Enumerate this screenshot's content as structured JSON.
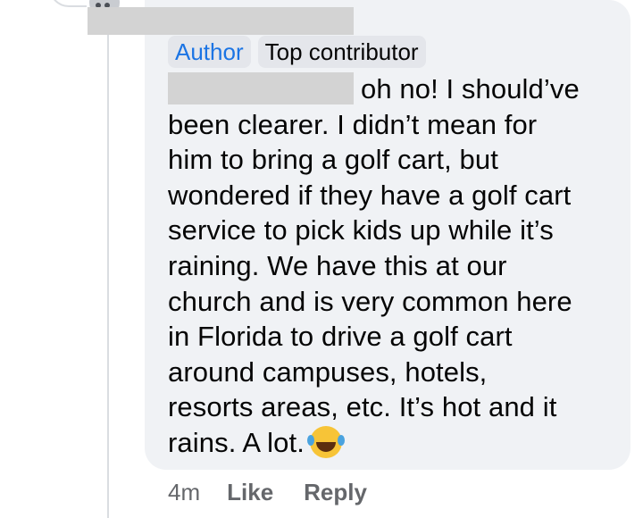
{
  "comment": {
    "badges": {
      "author": "Author",
      "top_contributor": "Top contributor"
    },
    "text_lines": [
      "oh no! I should’ve",
      "been clearer. I didn’t mean for",
      "him to bring a golf cart, but",
      "wondered if they have a golf cart",
      "service to pick kids up while it’s",
      "raining. We have this at our",
      "church and is very common here",
      "in Florida to drive a golf cart",
      "around campuses, hotels,",
      "resorts areas, etc. It’s hot and it",
      "rains. A lot."
    ],
    "emoji": "laughing-with-tears-emoji"
  },
  "meta": {
    "time": "4m",
    "like_label": "Like",
    "reply_label": "Reply"
  },
  "colors": {
    "bubble_bg": "#f0f2f5",
    "author_blue": "#1b74e4",
    "meta_gray": "#65676b",
    "redaction": "#d3d3d3"
  }
}
